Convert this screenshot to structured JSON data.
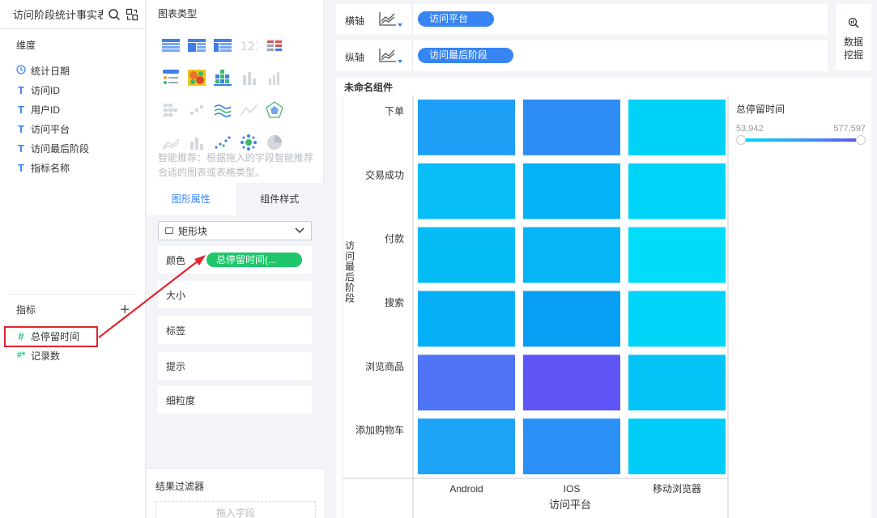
{
  "datasource": {
    "title": "访问阶段统计事实表"
  },
  "dimensions": {
    "title": "维度",
    "fields": [
      {
        "type_icon": "clock-icon",
        "label": "统计日期"
      },
      {
        "type_icon": "T",
        "label": "访问ID"
      },
      {
        "type_icon": "T",
        "label": "用户ID"
      },
      {
        "type_icon": "T",
        "label": "访问平台"
      },
      {
        "type_icon": "T",
        "label": "访问最后阶段"
      },
      {
        "type_icon": "T",
        "label": "指标名称"
      }
    ]
  },
  "measures": {
    "title": "指标",
    "add": "+",
    "fields": [
      {
        "type_icon": "#",
        "label": "总停留时间"
      },
      {
        "type_icon": "#*",
        "label": "记录数"
      }
    ]
  },
  "chart_types": {
    "title": "图表类型",
    "recommend": "智能推荐：根据拖入的字段智能推荐合适的图表或表格类型。"
  },
  "tabs": {
    "graph_props": "图形属性",
    "component_style": "组件样式"
  },
  "shape_select": {
    "value": "矩形块"
  },
  "props": {
    "color": {
      "label": "颜色",
      "field": "总停留时间(...",
      "pill_color": "#1fc66b"
    },
    "size": "大小",
    "label": "标签",
    "tooltip": "提示",
    "granularity": "细粒度"
  },
  "filter": {
    "title": "结果过滤器",
    "placeholder": "拖入字段"
  },
  "axes": {
    "x": {
      "label": "横轴",
      "field": "访问平台"
    },
    "y": {
      "label": "纵轴",
      "field": "访问最后阶段"
    }
  },
  "mining": {
    "label": "数据挖掘"
  },
  "component": {
    "title": "未命名组件"
  },
  "colors": {
    "accent": "#3685f2",
    "highlight": "#e0252f",
    "measure_green": "#1fc66b"
  },
  "chart_data": {
    "type": "heatmap",
    "x": [
      "Android",
      "IOS",
      "移动浏览器"
    ],
    "y": [
      "下单",
      "交易成功",
      "付款",
      "搜索",
      "浏览商品",
      "添加购物车"
    ],
    "xlabel": "访问平台",
    "ylabel": "访问最后阶段",
    "legend": {
      "title": "总停留时间",
      "min": "53,942",
      "max": "577,597",
      "position": "right"
    },
    "cells": [
      [
        "#1ea0f7",
        "#2e8cf5",
        "#00d2f7"
      ],
      [
        "#08bdf7",
        "#04b2f6",
        "#00d3f8"
      ],
      [
        "#05bcf7",
        "#05b5f6",
        "#00dcfa"
      ],
      [
        "#05b0f6",
        "#089ef4",
        "#00d4f8"
      ],
      [
        "#4f74f5",
        "#5f55f7",
        "#04c4f7"
      ],
      [
        "#1ea3f7",
        "#2a90f5",
        "#00cdf7"
      ]
    ]
  }
}
